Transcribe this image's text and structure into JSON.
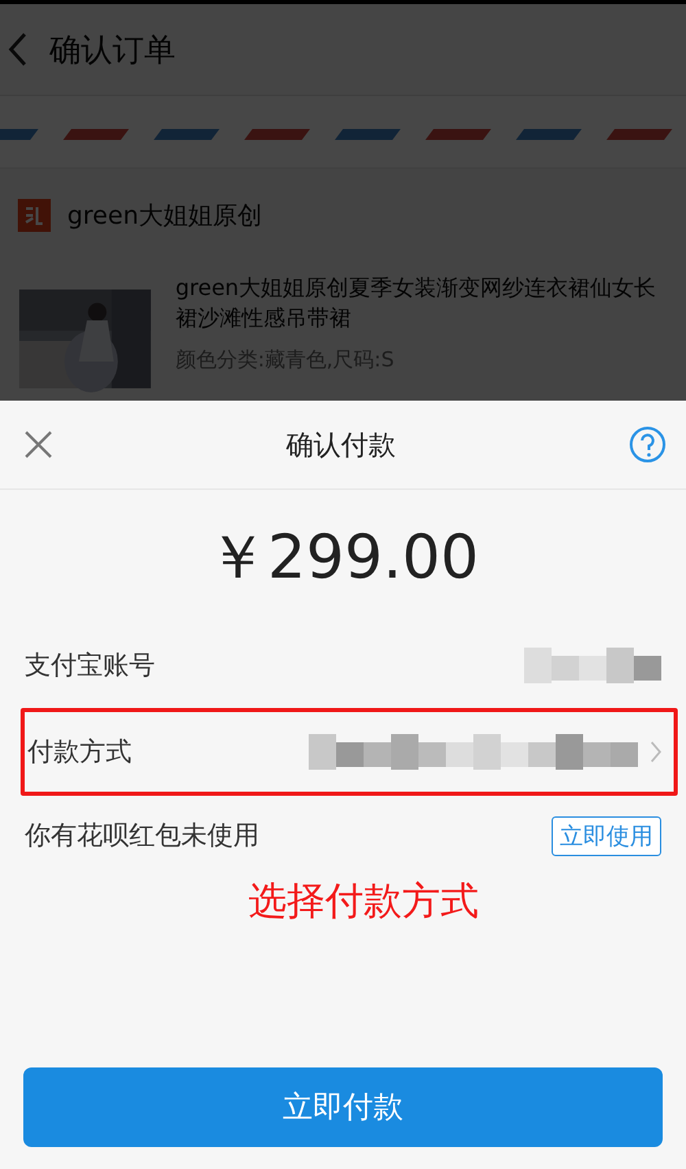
{
  "order_page": {
    "title": "确认订单",
    "shop": {
      "name": "green大姐姐原创"
    },
    "product": {
      "title": "green大姐姐原创夏季女装渐变网纱连衣裙仙女长裙沙滩性感吊带裙",
      "spec": "颜色分类:藏青色,尺码:S"
    }
  },
  "payment_sheet": {
    "title": "确认付款",
    "amount": "￥299.00",
    "rows": [
      {
        "label": "支付宝账号",
        "highlighted": false
      },
      {
        "label": "付款方式",
        "highlighted": true
      }
    ],
    "huabei": {
      "text": "你有花呗红包未使用",
      "button": "立即使用"
    },
    "annotation": "选择付款方式",
    "pay_button": "立即付款"
  }
}
